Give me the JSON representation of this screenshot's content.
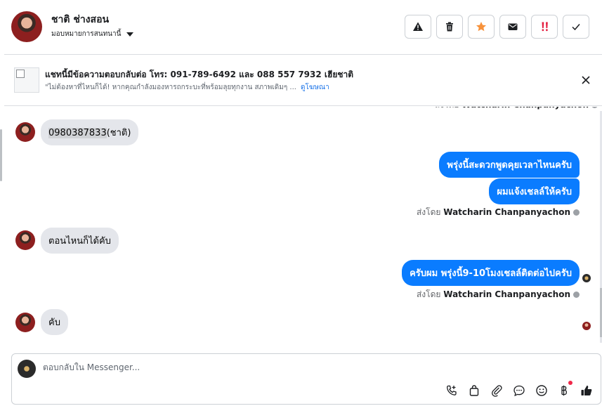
{
  "header": {
    "contact_name": "ชาติ ช่างสอน",
    "assign_label": "มอบหมายการสนทนานี้",
    "actions": [
      {
        "name": "report-spam-button",
        "icon": "warning-icon"
      },
      {
        "name": "delete-button",
        "icon": "trash-icon"
      },
      {
        "name": "star-button",
        "icon": "star-icon",
        "color": "#f7923b"
      },
      {
        "name": "mark-unread-button",
        "icon": "envelope-icon"
      },
      {
        "name": "follow-up-button",
        "icon": "exclamation-icon",
        "color": "#e41e3f"
      },
      {
        "name": "mark-done-button",
        "icon": "check-icon"
      }
    ]
  },
  "banner": {
    "title": "แชทนี้มีข้อความตอบกลับต่อ โทร: 091-789-6492 และ 088 557 7932 เฮียชาติ",
    "description": "\"ไม่ต้องหาที่ไหนก็ได้! หากคุณกำลังมองหารถกระบะที่พร้อมลุยทุกงาน สภาพเดิมๆ ...",
    "link": "ดูโฆษณา"
  },
  "conversation": {
    "sent_by_prefix": "ส่งโดย",
    "sender_name": "Watcharin Chanpanyachon",
    "messages": {
      "in1_highlight": "0980387833",
      "in1_rest": "(ชาติ)",
      "out1": "พรุ่งนี้สะดวกพูดคุยเวลาไหนครับ",
      "out2": "ผมแจ้งเชลล์ให้ครับ",
      "in2": "ตอนไหนก็ได้คับ",
      "out3": "ครับผม พรุ่งนี้9-10โมงเชลล์ติดต่อไปครับ",
      "in3": "คับ"
    }
  },
  "composer": {
    "placeholder": "ตอบกลับใน Messenger...",
    "tools": [
      "call-icon",
      "shopping-bag-icon",
      "paperclip-icon",
      "chat-bubble-icon",
      "emoji-icon",
      "baht-icon",
      "thumbs-up-icon"
    ]
  },
  "colors": {
    "accent": "#0a7cff",
    "incoming_bubble": "#e4e6eb",
    "star": "#f7923b",
    "alert": "#e41e3f"
  }
}
